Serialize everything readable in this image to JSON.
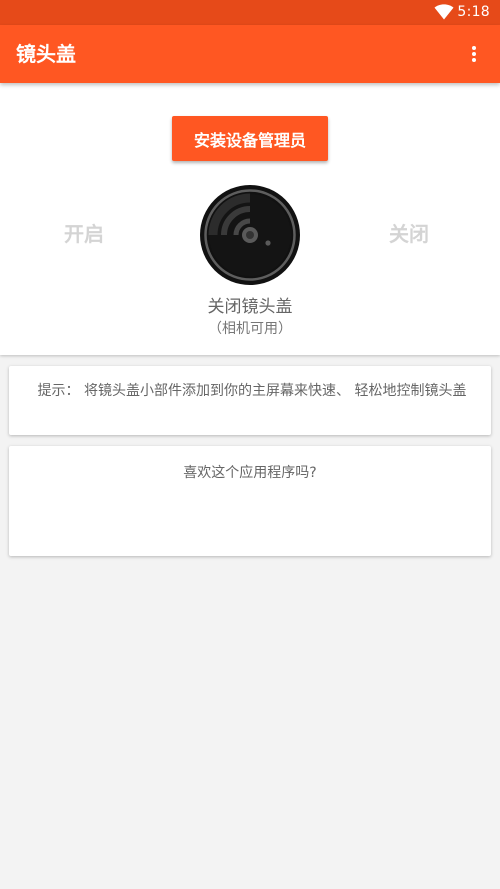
{
  "status_bar": {
    "time": "5:18",
    "wifi_icon": "wifi-icon"
  },
  "app_bar": {
    "title": "镜头盖",
    "overflow_icon": "more-vert-icon"
  },
  "main": {
    "install_button_label": "安装设备管理员",
    "on_label": "开启",
    "off_label": "关闭",
    "lens_icon": "camera-lens-icon",
    "lens_title": "关闭镜头盖",
    "lens_subtitle": "（相机可用）"
  },
  "tip": {
    "text": "提示： 将镜头盖小部件添加到你的主屏幕来快速、 轻松地控制镜头盖"
  },
  "rate": {
    "question": "喜欢这个应用程序吗?"
  },
  "colors": {
    "status_bar": "#e64a19",
    "app_bar": "#ff5722",
    "accent": "#ff5722",
    "background": "#f3f3f3"
  }
}
